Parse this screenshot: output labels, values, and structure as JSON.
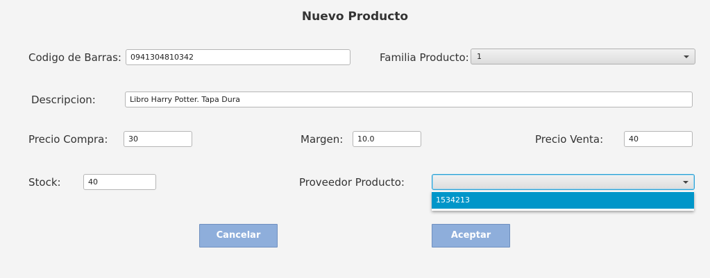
{
  "form": {
    "title": "Nuevo Producto",
    "codigo_label": "Codigo de Barras:",
    "codigo_value": "0941304810342",
    "familia_label": "Familia Producto:",
    "familia_value": "1",
    "descripcion_label": "Descripcion:",
    "descripcion_value": "Libro Harry Potter. Tapa Dura",
    "precio_compra_label": "Precio Compra:",
    "precio_compra_value": "30",
    "margen_label": "Margen:",
    "margen_value": "10.0",
    "precio_venta_label": "Precio Venta:",
    "precio_venta_value": "40",
    "stock_label": "Stock:",
    "stock_value": "40",
    "proveedor_label": "Proveedor Producto:",
    "proveedor_value": "",
    "proveedor_options": [
      "1534213"
    ],
    "cancel_label": "Cancelar",
    "accept_label": "Aceptar"
  },
  "colors": {
    "background": "#f4f4f4",
    "button": "#8eaedb",
    "selection": "#0096c9",
    "focus": "#2aa0d4"
  }
}
